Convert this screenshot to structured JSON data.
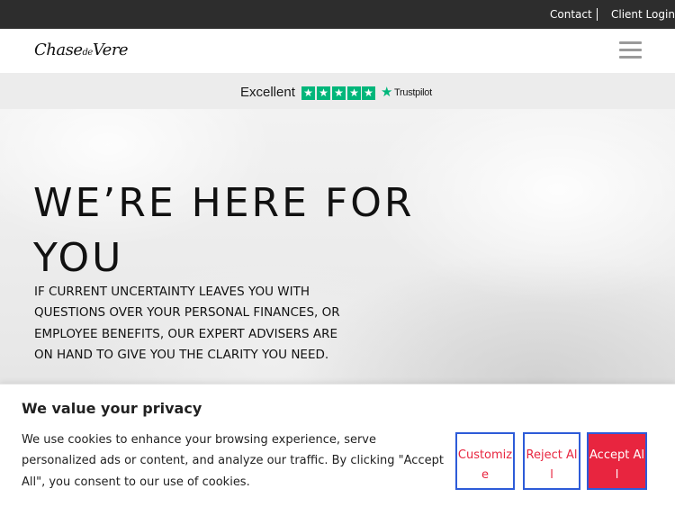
{
  "topbar": {
    "contact": "Contact",
    "client_login": "Client Login"
  },
  "header": {
    "logo_main1": "Chase",
    "logo_de": "de",
    "logo_main2": "Vere"
  },
  "trustbar": {
    "label": "Excellent",
    "brand": "Trustpilot",
    "rating_stars": 5,
    "star_color": "#00b67a"
  },
  "hero": {
    "title": "WE’RE HERE FOR YOU",
    "body": "IF CURRENT UNCERTAINTY LEAVES YOU WITH QUESTIONS OVER YOUR PERSONAL FINANCES, OR EMPLOYEE BENEFITS, OUR EXPERT ADVISERS ARE ON HAND TO GIVE YOU THE CLARITY YOU NEED."
  },
  "cookie": {
    "title": "We value your privacy",
    "text": "We use cookies to enhance your browsing experience, serve personalized ads or content, and analyze our traffic. By clicking \"Accept All\", you consent to our use of cookies.",
    "customize": "Customize",
    "reject": "Reject All",
    "accept": "Accept All",
    "accent_color": "#e8253f",
    "border_color": "#2d5bd8"
  }
}
